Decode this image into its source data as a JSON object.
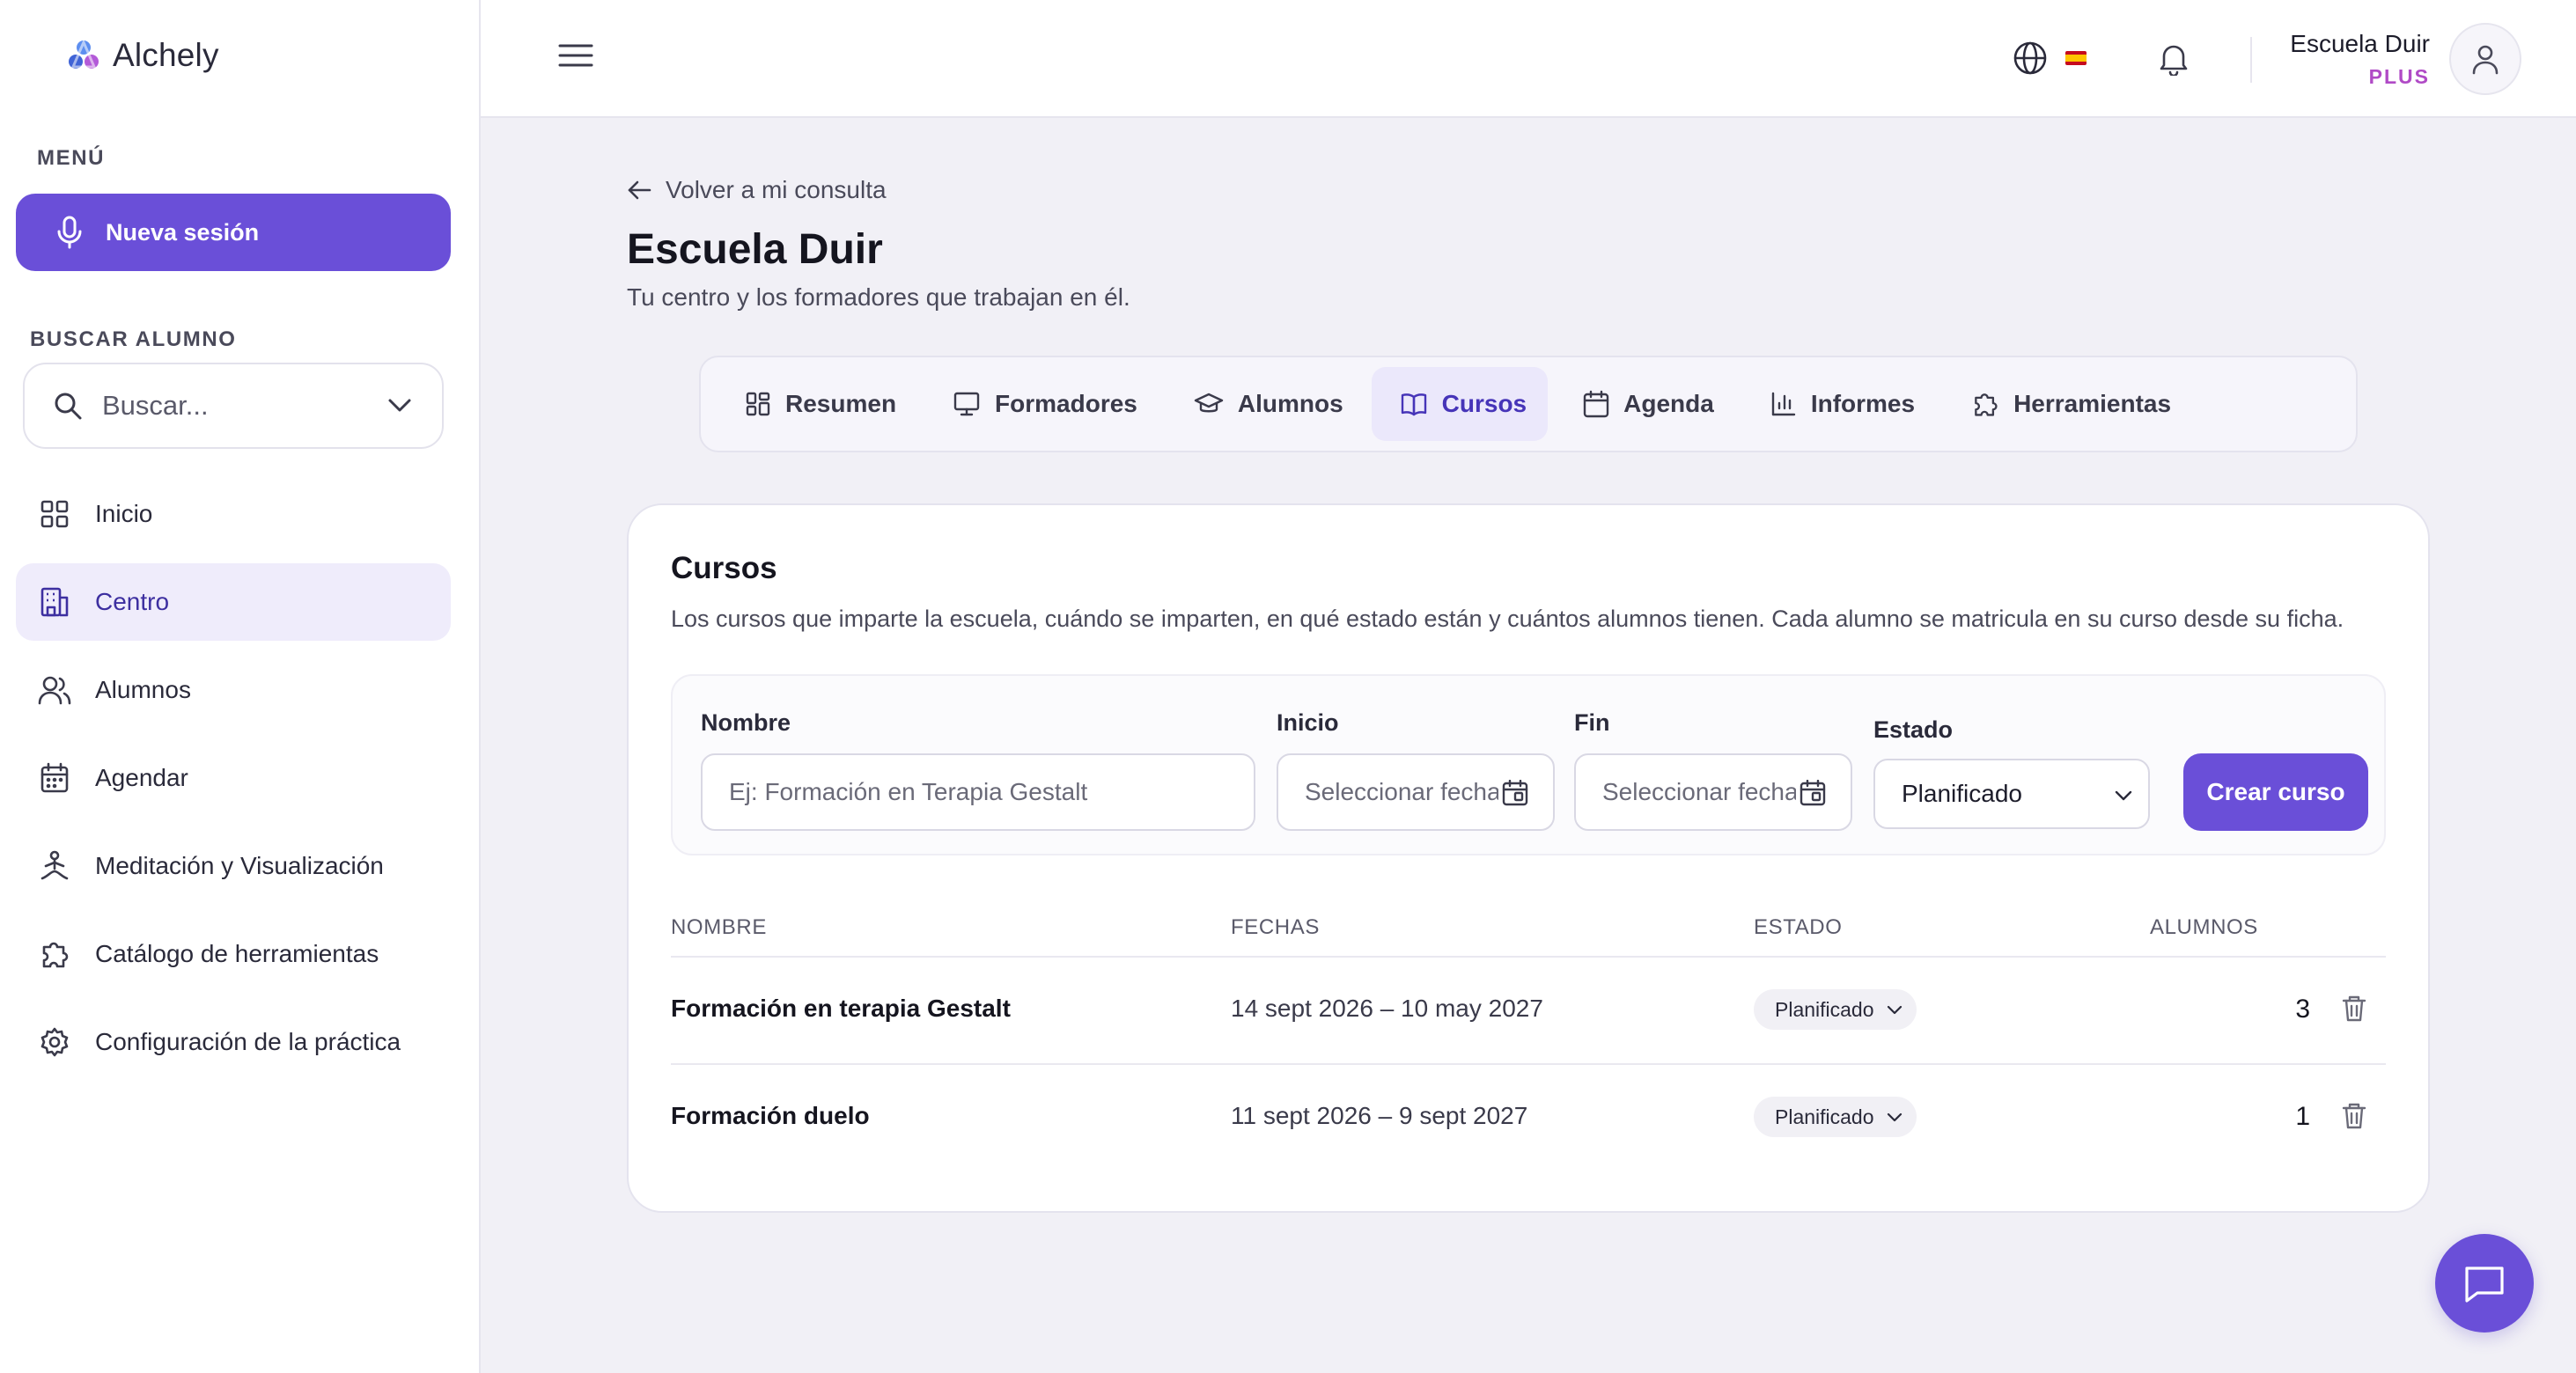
{
  "app": {
    "name": "Alchely"
  },
  "sidebar": {
    "menu_label": "MENÚ",
    "new_session_label": "Nueva sesión",
    "search_label": "BUSCAR ALUMNO",
    "search_placeholder": "Buscar...",
    "items": [
      {
        "label": "Inicio",
        "icon": "grid-icon"
      },
      {
        "label": "Centro",
        "icon": "building-icon",
        "active": true
      },
      {
        "label": "Alumnos",
        "icon": "users-icon"
      },
      {
        "label": "Agendar",
        "icon": "calendar-icon"
      },
      {
        "label": "Meditación y Visualización",
        "icon": "meditation-icon"
      },
      {
        "label": "Catálogo de herramientas",
        "icon": "puzzle-icon"
      },
      {
        "label": "Configuración de la práctica",
        "icon": "gear-icon"
      }
    ]
  },
  "topbar": {
    "user_name": "Escuela Duir",
    "user_plan": "PLUS",
    "language_flag": "es-flag-icon"
  },
  "main": {
    "back_link": "Volver a mi consulta",
    "title": "Escuela Duir",
    "subtitle": "Tu centro y los formadores que trabajan en él.",
    "tabs": [
      {
        "label": "Resumen",
        "icon": "grid-icon"
      },
      {
        "label": "Formadores",
        "icon": "presentation-icon"
      },
      {
        "label": "Alumnos",
        "icon": "graduation-cap-icon"
      },
      {
        "label": "Cursos",
        "icon": "book-icon",
        "active": true
      },
      {
        "label": "Agenda",
        "icon": "calendar-icon"
      },
      {
        "label": "Informes",
        "icon": "bar-chart-icon"
      },
      {
        "label": "Herramientas",
        "icon": "puzzle-icon"
      }
    ]
  },
  "courses": {
    "title": "Cursos",
    "description": "Los cursos que imparte la escuela, cuándo se imparten, en qué estado están y cuántos alumnos tienen. Cada alumno se matricula en su curso desde su ficha.",
    "form": {
      "name_label": "Nombre",
      "name_placeholder": "Ej: Formación en Terapia Gestalt",
      "start_label": "Inicio",
      "start_placeholder": "Seleccionar fecha",
      "end_label": "Fin",
      "end_placeholder": "Seleccionar fecha",
      "status_label": "Estado",
      "status_value": "Planificado",
      "create_button": "Crear curso"
    },
    "table": {
      "headers": {
        "name": "NOMBRE",
        "dates": "FECHAS",
        "status": "ESTADO",
        "students": "ALUMNOS"
      },
      "rows": [
        {
          "name": "Formación en terapia Gestalt",
          "dates": "14 sept 2026 – 10 may 2027",
          "status": "Planificado",
          "students": "3"
        },
        {
          "name": "Formación duelo",
          "dates": "11 sept 2026 – 9 sept 2027",
          "status": "Planificado",
          "students": "1"
        }
      ]
    }
  },
  "colors": {
    "accent": "#6a4fd8",
    "plan": "#b04ac6",
    "active_bg": "#efecfb"
  }
}
